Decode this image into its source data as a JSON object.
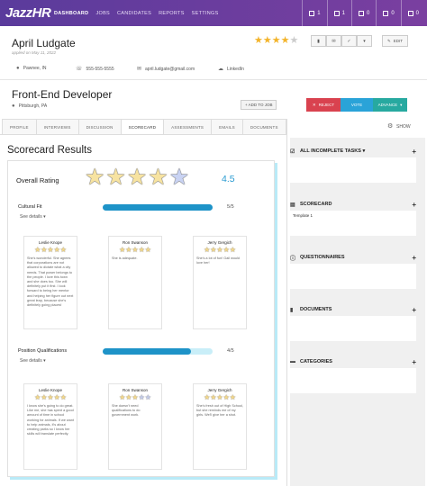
{
  "nav": {
    "logo": "JazzHR",
    "items": [
      "DASHBOARD",
      "JOBS",
      "CANDIDATES",
      "REPORTS",
      "SETTINGS"
    ],
    "boxes": [
      "1",
      "1",
      "0",
      "0",
      "0"
    ]
  },
  "candidate": {
    "name": "April Ludgate",
    "applied": "applied on May 11, 2022",
    "rating_stars": 4,
    "location": "Pawnee, IN",
    "phone": "555-555-5555",
    "email": "april.ludgate@gmail.com",
    "linkedin": "LinkedIn"
  },
  "toolbar": {
    "edit": "EDIT",
    "icons": [
      "comment-icon",
      "mail-icon",
      "check-icon",
      "dropdown-icon"
    ]
  },
  "job": {
    "title": "Front-End Developer",
    "location": "Pittsburgh, PA",
    "add_to_job": "+ ADD TO JOB",
    "reject": "REJECT",
    "vote": "VOTE",
    "advance": "ADVANCE"
  },
  "tabs": [
    "PROFILE",
    "INTERVIEWS",
    "DISCUSSION",
    "SCORECARD",
    "ASSESSMENTS",
    "EMAILS",
    "DOCUMENTS"
  ],
  "active_tab": "SCORECARD",
  "show_label": "SHOW",
  "scorecard": {
    "title": "Scorecard Results",
    "overall_label": "Overall Rating",
    "overall_value": "4.5",
    "overall_stars": 4.5,
    "sections": [
      {
        "label": "Cultural Fit",
        "see_details": "See details",
        "score": "5/5",
        "fill": 1.0,
        "reviews": [
          {
            "name": "Leslie Knope",
            "stars": 5,
            "text": "She's wonderful. She agrees that corporations are not allowed to dictate what a city needs. That power belongs to the people. I love this town and she does too. She will definitely put it first. I look forward to being her mentor and helping her figure out next great leap, because she's definitely going places!"
          },
          {
            "name": "Ron Swanson",
            "stars": 5,
            "text": "She is adequate."
          },
          {
            "name": "Jerry Gergich",
            "stars": 5,
            "text": "She's a lot of fun! Gail would love her!"
          }
        ]
      },
      {
        "label": "Position Qualifications",
        "see_details": "See details",
        "score": "4/5",
        "fill": 0.8,
        "reviews": [
          {
            "name": "Leslie Knope",
            "stars": 5,
            "text": "I know she's going to do great. Like me, she has spent a good amount of time in school working for animals. If we want to help animals, it's about creating parks so I know her skills will translate perfectly."
          },
          {
            "name": "Ron Swanson",
            "stars": 3,
            "text": "She doesn't need qualifications to do government work."
          },
          {
            "name": "Jerry Gergich",
            "stars": 5,
            "text": "She's fresh out of High School, but she reminds me of my girls. We'll give her a shot."
          }
        ]
      }
    ]
  },
  "sidebar": {
    "panels": [
      {
        "title": "ALL INCOMPLETE TASKS",
        "icon": "checkbox-icon",
        "content": ""
      },
      {
        "title": "SCORECARD",
        "icon": "scorecard-icon",
        "content": "Template 1"
      },
      {
        "title": "QUESTIONNAIRES",
        "icon": "question-icon",
        "content": ""
      },
      {
        "title": "DOCUMENTS",
        "icon": "document-icon",
        "content": ""
      },
      {
        "title": "CATEGORIES",
        "icon": "folder-icon",
        "content": ""
      }
    ]
  },
  "colors": {
    "nav": "#6a3fa0",
    "accent": "#2a9bd1",
    "reject": "#d9424f",
    "vote": "#2aa3d8",
    "advance": "#27a9a0",
    "star": "#f3b42b"
  }
}
